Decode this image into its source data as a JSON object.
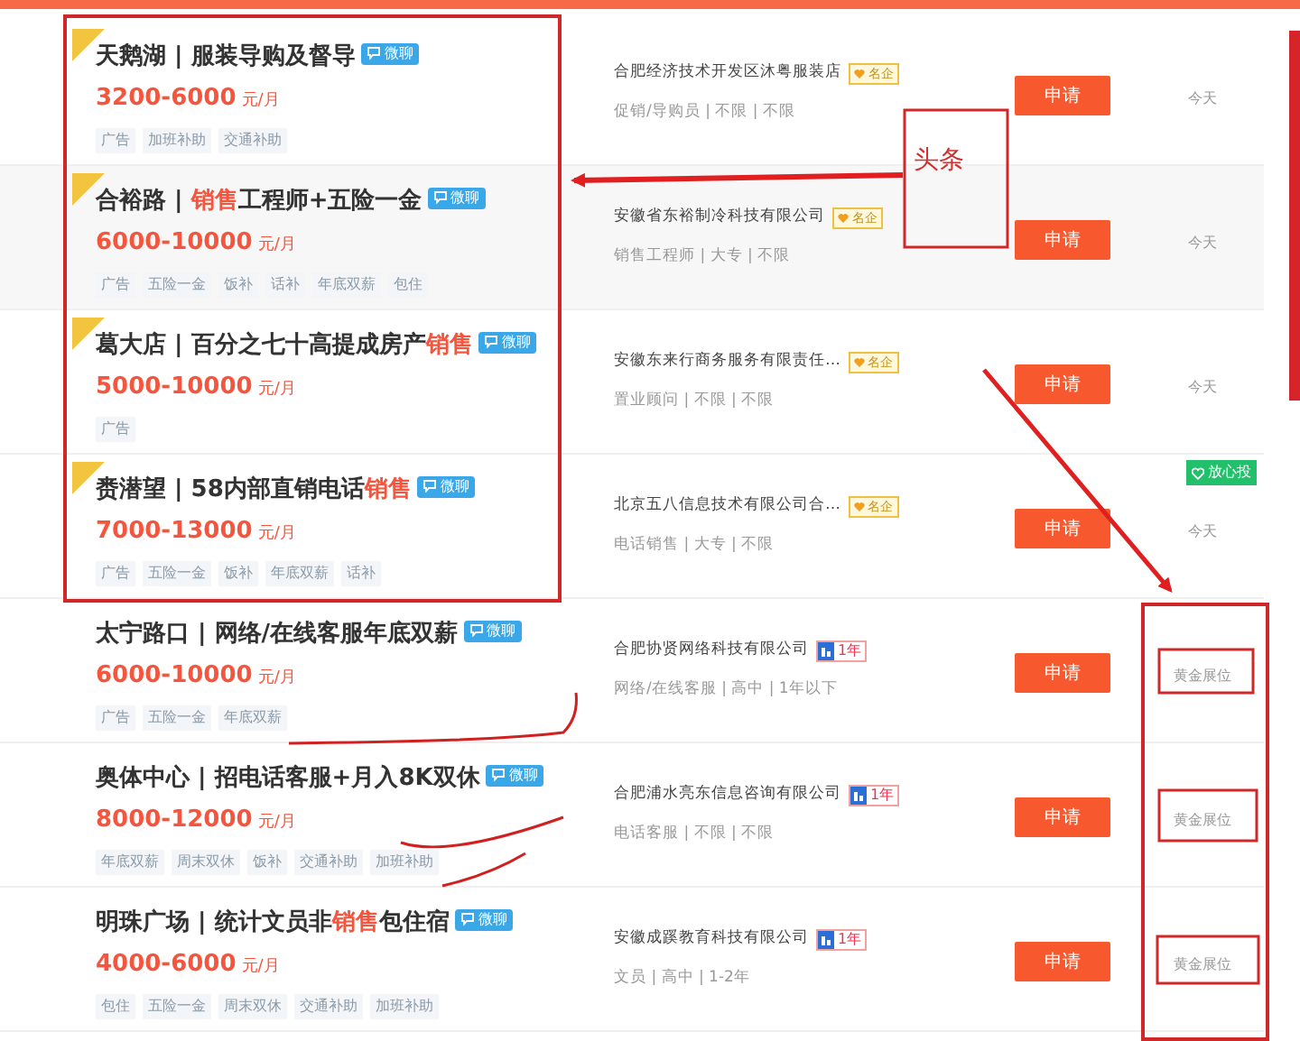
{
  "jobs": [
    {
      "ribbon": true,
      "highlighted": false,
      "title": [
        {
          "text": "天鹅湖 | 服装导购及督导",
          "highlight": false
        }
      ],
      "chat": "微聊",
      "salary": "3200-6000",
      "unit": "元/月",
      "tags": [
        "广告",
        "加班补助",
        "交通补助"
      ],
      "company": "合肥经济技术开发区沐粤服装店",
      "badge": {
        "kind": "vip",
        "text": "名企"
      },
      "meta": "促销/导购员 | 不限 | 不限",
      "apply": "申请",
      "date": "今天"
    },
    {
      "ribbon": true,
      "highlighted": true,
      "title": [
        {
          "text": "合裕路 | ",
          "highlight": false
        },
        {
          "text": "销售",
          "highlight": true
        },
        {
          "text": "工程师+五险一金",
          "highlight": false
        }
      ],
      "chat": "微聊",
      "salary": "6000-10000",
      "unit": "元/月",
      "tags": [
        "广告",
        "五险一金",
        "饭补",
        "话补",
        "年底双薪",
        "包住"
      ],
      "company": "安徽省东裕制冷科技有限公司",
      "badge": {
        "kind": "vip",
        "text": "名企"
      },
      "meta": "销售工程师 | 大专 | 不限",
      "apply": "申请",
      "date": "今天"
    },
    {
      "ribbon": true,
      "highlighted": false,
      "title": [
        {
          "text": "葛大店 | 百分之七十高提成房产",
          "highlight": false
        },
        {
          "text": "销售",
          "highlight": true
        }
      ],
      "chat": "微聊",
      "salary": "5000-10000",
      "unit": "元/月",
      "tags": [
        "广告"
      ],
      "company": "安徽东来行商务服务有限责任…",
      "badge": {
        "kind": "vip",
        "text": "名企"
      },
      "meta": "置业顾问 | 不限 | 不限",
      "apply": "申请",
      "date": "今天"
    },
    {
      "ribbon": true,
      "highlighted": false,
      "title": [
        {
          "text": "赉潜望 | 58内部直销电话",
          "highlight": false
        },
        {
          "text": "销售",
          "highlight": true
        }
      ],
      "chat": "微聊",
      "salary": "7000-13000",
      "unit": "元/月",
      "tags": [
        "广告",
        "五险一金",
        "饭补",
        "年底双薪",
        "话补"
      ],
      "company": "北京五八信息技术有限公司合…",
      "badge": {
        "kind": "vip",
        "text": "名企"
      },
      "meta": "电话销售 | 大专 | 不限",
      "apply": "申请",
      "date": "今天",
      "trust": "放心投"
    },
    {
      "ribbon": false,
      "highlighted": false,
      "title": [
        {
          "text": "太宁路口 | 网络/在线客服年底双薪",
          "highlight": false
        }
      ],
      "chat": "微聊",
      "salary": "6000-10000",
      "unit": "元/月",
      "tags": [
        "广告",
        "五险一金",
        "年底双薪"
      ],
      "company": "合肥协贤网络科技有限公司",
      "badge": {
        "kind": "years",
        "text": "1年"
      },
      "meta": "网络/在线客服 | 高中 | 1年以下",
      "apply": "申请",
      "date": "黄金展位"
    },
    {
      "ribbon": false,
      "highlighted": false,
      "title": [
        {
          "text": "奥体中心 | 招电话客服+月入8K双休",
          "highlight": false
        }
      ],
      "chat": "微聊",
      "salary": "8000-12000",
      "unit": "元/月",
      "tags": [
        "年底双薪",
        "周末双休",
        "饭补",
        "交通补助",
        "加班补助"
      ],
      "company": "合肥浦水亮东信息咨询有限公司",
      "badge": {
        "kind": "years",
        "text": "1年"
      },
      "meta": "电话客服 | 不限 | 不限",
      "apply": "申请",
      "date": "黄金展位"
    },
    {
      "ribbon": false,
      "highlighted": false,
      "title": [
        {
          "text": "明珠广场 | 统计文员非",
          "highlight": false
        },
        {
          "text": "销售",
          "highlight": true
        },
        {
          "text": "包住宿",
          "highlight": false
        }
      ],
      "chat": "微聊",
      "salary": "4000-6000",
      "unit": "元/月",
      "tags": [
        "包住",
        "五险一金",
        "周末双休",
        "交通补助",
        "加班补助"
      ],
      "company": "安徽成蹊教育科技有限公司",
      "badge": {
        "kind": "years",
        "text": "1年"
      },
      "meta": "文员 | 高中 | 1-2年",
      "apply": "申请",
      "date": "黄金展位"
    }
  ],
  "annotation": {
    "label": "头条"
  }
}
